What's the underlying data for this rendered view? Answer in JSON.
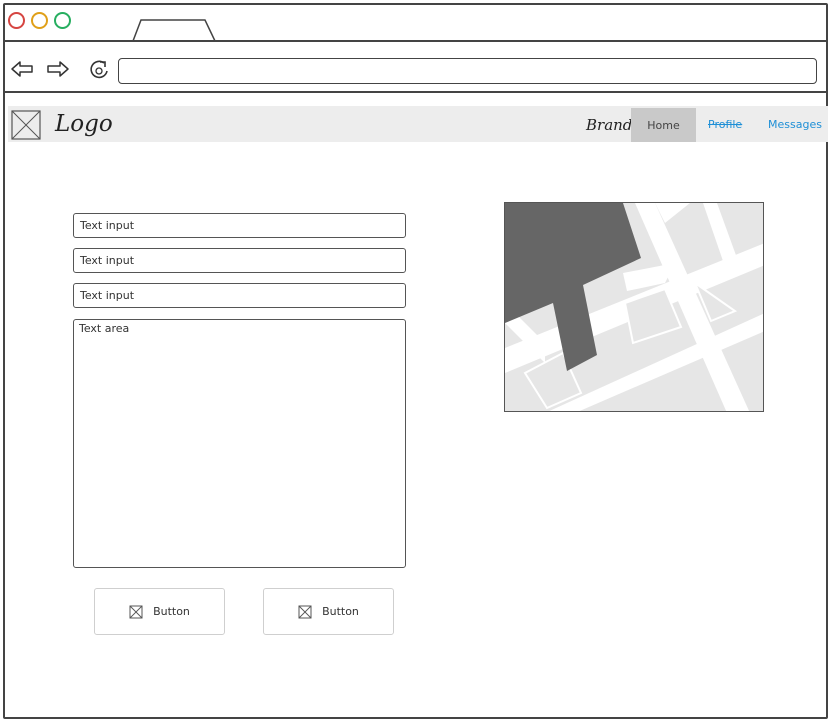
{
  "window": {
    "controls": [
      "close",
      "minimize",
      "maximize"
    ],
    "url": ""
  },
  "header": {
    "logo_text": "Logo",
    "brand": "Brand",
    "nav": {
      "home": "Home",
      "profile": "Profile",
      "messages": "Messages"
    }
  },
  "form": {
    "inputs": [
      {
        "placeholder": "Text input"
      },
      {
        "placeholder": "Text input"
      },
      {
        "placeholder": "Text input"
      }
    ],
    "textarea_placeholder": "Text area",
    "buttons": [
      "Button",
      "Button"
    ]
  },
  "colors": {
    "link": "#1e8fd6",
    "active_nav": "#c9c9c9",
    "header_bg": "#ededed"
  }
}
